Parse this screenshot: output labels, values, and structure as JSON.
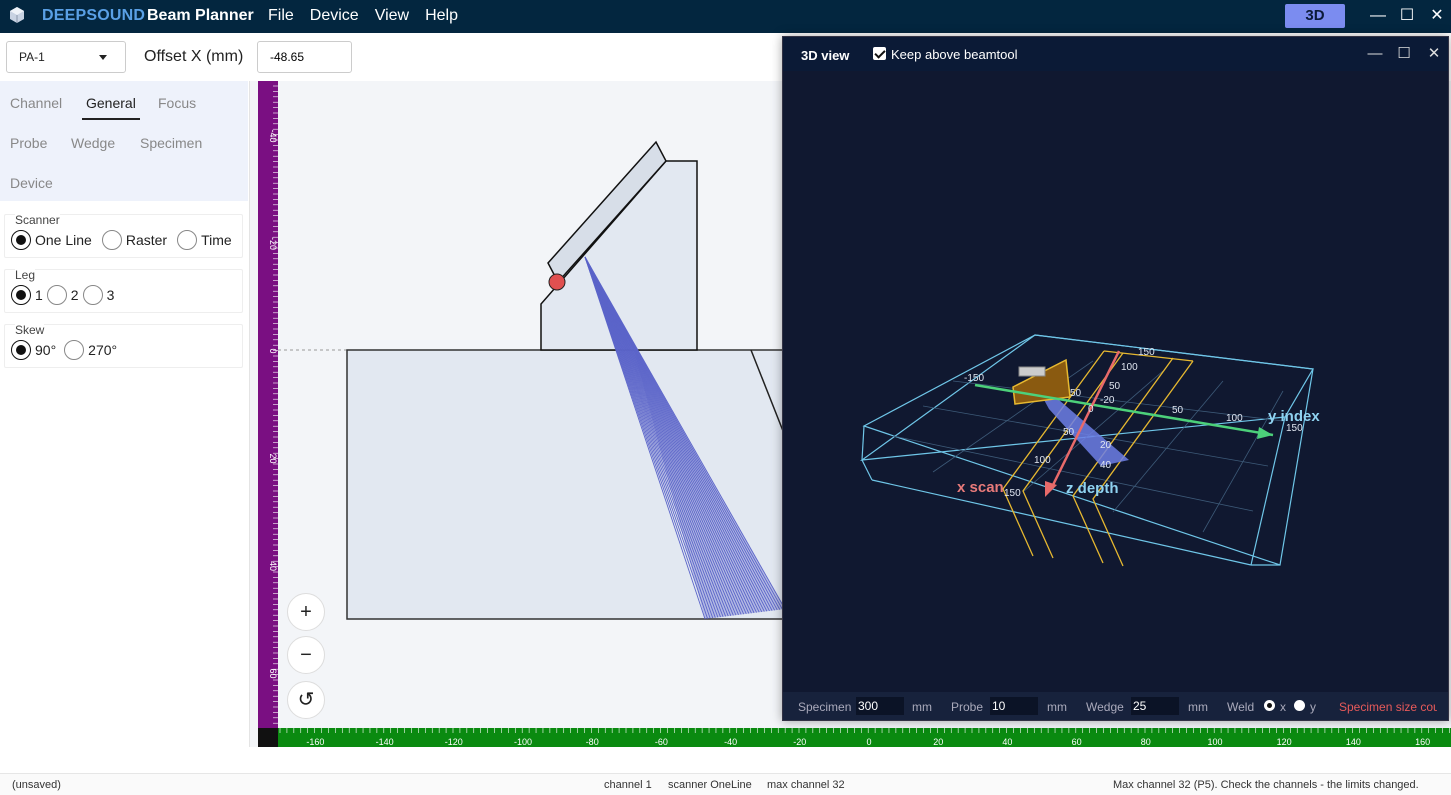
{
  "app": {
    "brand": "DEEPSOUND",
    "name": "Beam Planner",
    "menu": [
      "File",
      "Device",
      "View",
      "Help"
    ],
    "view_button": "3D"
  },
  "toolbar": {
    "probe_selected": "PA-1",
    "offset_label": "Offset X (mm)",
    "offset_value": "-48.65"
  },
  "tabs": {
    "row1": [
      "Channel",
      "General",
      "Focus"
    ],
    "row2": [
      "Probe",
      "Wedge",
      "Specimen"
    ],
    "row3": [
      "Device"
    ],
    "active": "General"
  },
  "scanner": {
    "title": "Scanner",
    "options": [
      "One Line",
      "Raster",
      "Time"
    ],
    "selected": "One Line"
  },
  "leg": {
    "title": "Leg",
    "options": [
      "1",
      "2",
      "3"
    ],
    "selected": "1"
  },
  "skew": {
    "title": "Skew",
    "options": [
      "90°",
      "270°"
    ],
    "selected": "90°"
  },
  "rulers": {
    "vertical_ticks": [
      "-40",
      "-20",
      "0",
      "20",
      "40",
      "60"
    ],
    "horizontal_ticks": [
      "-160",
      "-140",
      "-120",
      "-100",
      "-80",
      "-60",
      "-40",
      "-20",
      "0",
      "20",
      "40",
      "60",
      "80",
      "100",
      "120",
      "140",
      "160"
    ]
  },
  "zoom": {
    "in": "+",
    "out": "−",
    "reset": "↺"
  },
  "view3d": {
    "title": "3D view",
    "keep_above_label": "Keep above beamtool",
    "keep_above_checked": true,
    "axis_labels": {
      "x": "x scan",
      "y": "y index",
      "z": "z depth"
    },
    "tick_labels": [
      "-150",
      "50",
      "0",
      "-20",
      "50",
      "100",
      "150",
      "50",
      "100",
      "150",
      "50",
      "100",
      "20",
      "40",
      "150",
      "100",
      "150"
    ],
    "footer": {
      "specimen_label": "Specimen",
      "specimen_value": "300",
      "specimen_unit": "mm",
      "probe_label": "Probe",
      "probe_value": "10",
      "probe_unit": "mm",
      "wedge_label": "Wedge",
      "wedge_value": "25",
      "wedge_unit": "mm",
      "weld_label": "Weld",
      "weld_x": "x",
      "weld_y": "y",
      "weld_selected": "x",
      "warning": "Specimen size coul"
    }
  },
  "status": {
    "file": "(unsaved)",
    "channel": "channel 1",
    "scanner": "scanner OneLine",
    "max_channel": "max channel 32",
    "message": "Max channel 32 (P5). Check the channels - the limits changed."
  },
  "colors": {
    "titlebar": "#03263f",
    "accent": "#7b8cf0",
    "vruler": "#7a0f82",
    "hruler": "#0a8a10",
    "beam": "#5b64c9",
    "wedge_fill": "#e2e8f1"
  }
}
